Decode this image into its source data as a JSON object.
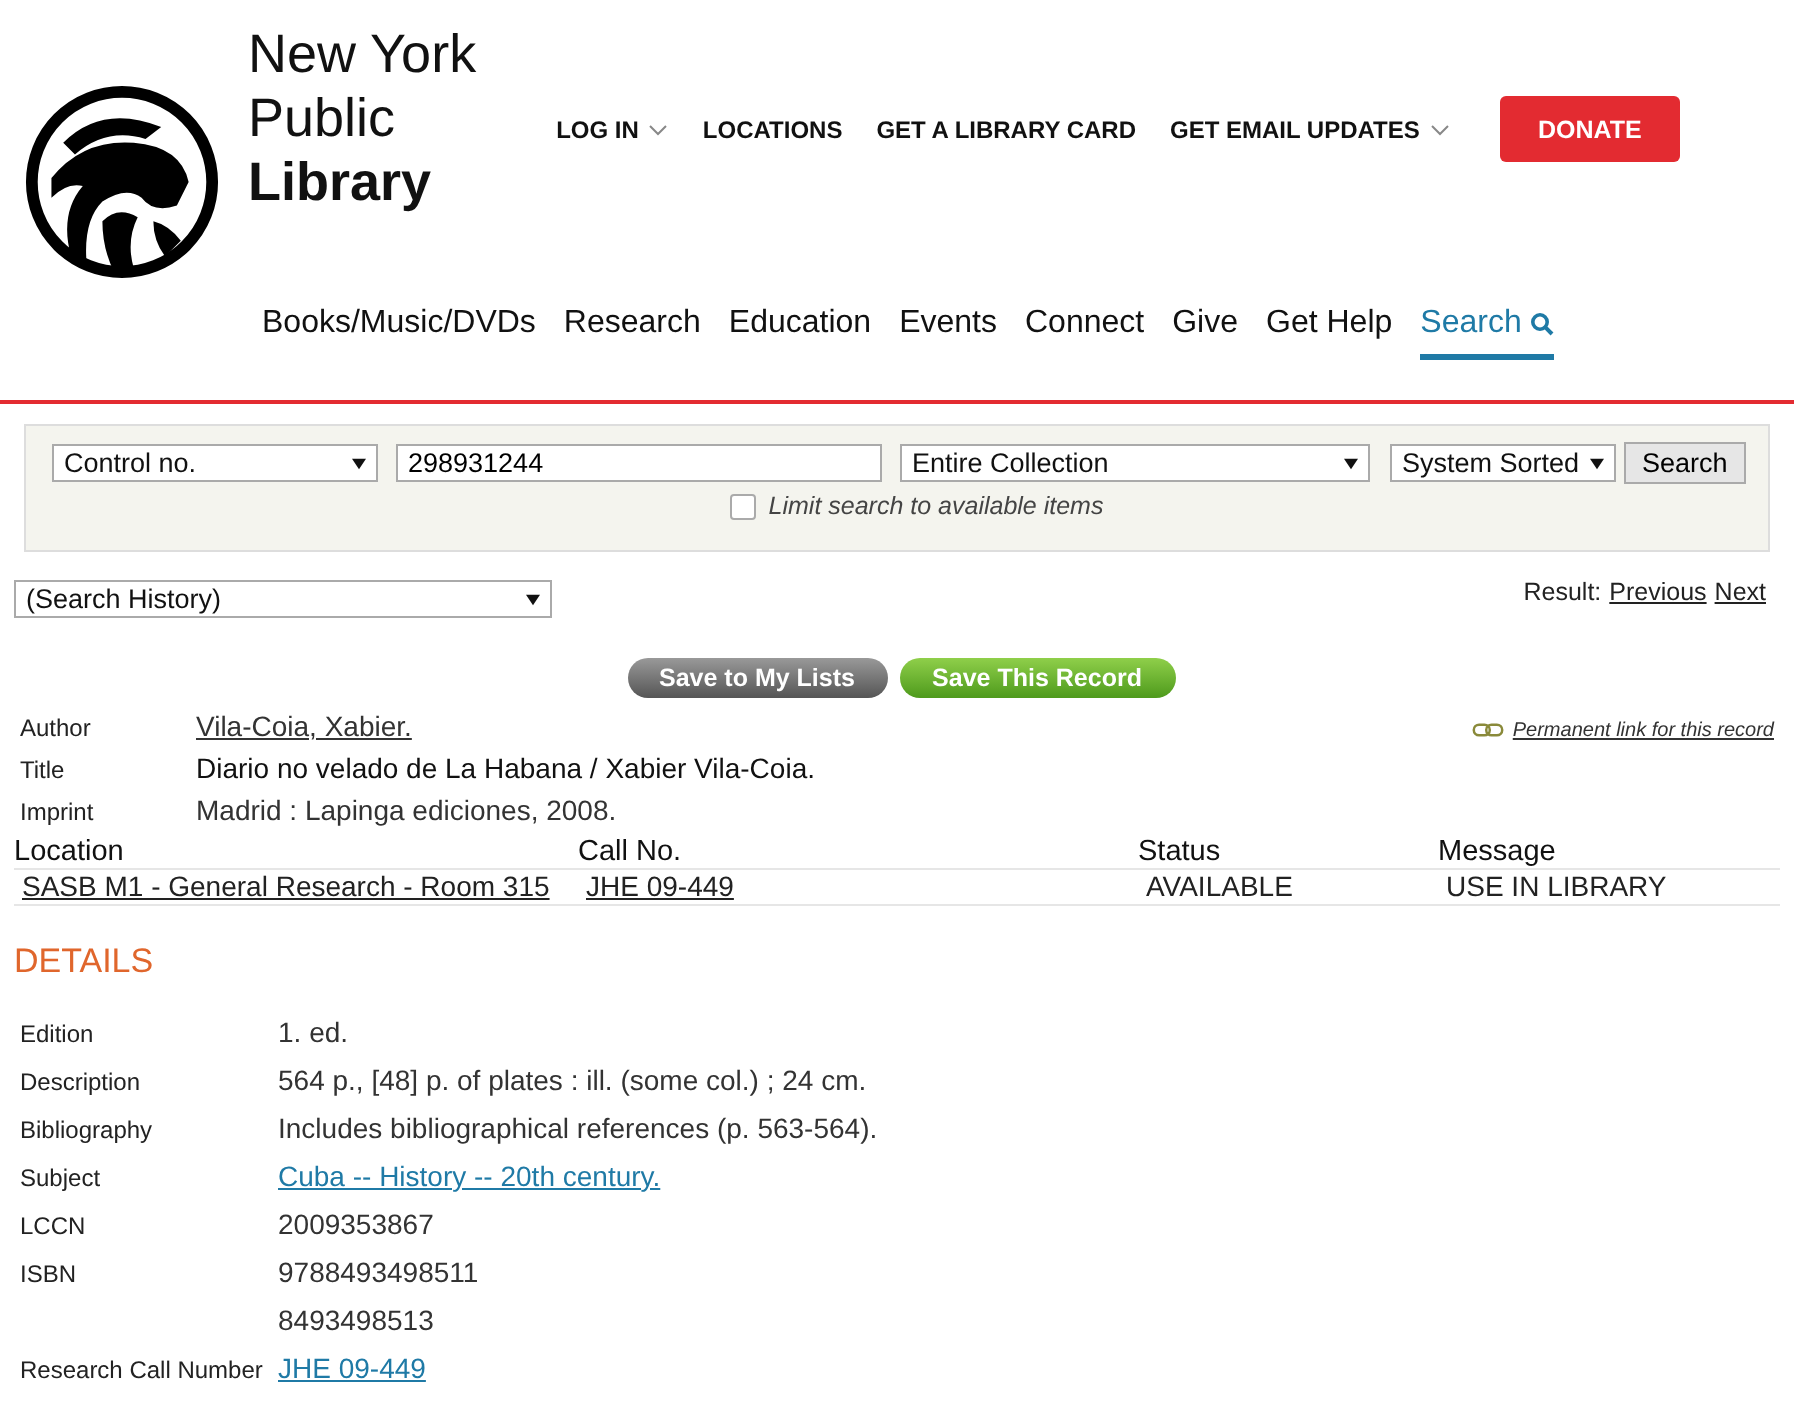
{
  "header": {
    "logo_lines": [
      "New York",
      "Public",
      "Library"
    ],
    "top_nav": [
      {
        "label": "LOG IN",
        "has_menu": true
      },
      {
        "label": "LOCATIONS",
        "has_menu": false
      },
      {
        "label": "GET A LIBRARY CARD",
        "has_menu": false
      },
      {
        "label": "GET EMAIL UPDATES",
        "has_menu": true
      }
    ],
    "donate": "DONATE",
    "main_nav": [
      {
        "label": "Books/Music/DVDs",
        "selected": false
      },
      {
        "label": "Research",
        "selected": false
      },
      {
        "label": "Education",
        "selected": false
      },
      {
        "label": "Events",
        "selected": false
      },
      {
        "label": "Connect",
        "selected": false
      },
      {
        "label": "Give",
        "selected": false
      },
      {
        "label": "Get Help",
        "selected": false
      },
      {
        "label": "Search",
        "selected": true
      }
    ]
  },
  "search_form": {
    "field_select": "Control no.",
    "query": "298931244",
    "scope_select": "Entire Collection",
    "sort_select": "System Sorted",
    "button": "Search",
    "limit": {
      "label": "Limit search to available items",
      "checked": false
    }
  },
  "search_history": "(Search History)",
  "result_nav": {
    "label": "Result:",
    "links": [
      "Previous",
      "Next"
    ]
  },
  "actions": [
    {
      "label": "Save to My Lists",
      "kind": "grey"
    },
    {
      "label": "Save This Record",
      "kind": "green"
    }
  ],
  "permanent_link": "Permanent link for this record",
  "record": [
    {
      "label": "Author",
      "value": "Vila-Coia, Xabier.",
      "link": true
    },
    {
      "label": "Title",
      "value": "Diario no velado de La Habana / Xabier Vila-Coia.",
      "link": false
    },
    {
      "label": "Imprint",
      "value": "Madrid : Lapinga ediciones, 2008.",
      "link": false
    }
  ],
  "holdings": {
    "columns": [
      "Location",
      "Call No.",
      "Status",
      "Message"
    ],
    "rows": [
      [
        {
          "text": "SASB M1 - General Research - Room 315",
          "link": true
        },
        {
          "text": "JHE 09-449",
          "link": true
        },
        {
          "text": "AVAILABLE",
          "link": false
        },
        {
          "text": "USE IN LIBRARY",
          "link": false
        }
      ]
    ]
  },
  "details": {
    "heading": "DETAILS",
    "fields": [
      {
        "label": "Edition",
        "values": [
          {
            "text": "1. ed.",
            "link": false
          }
        ]
      },
      {
        "label": "Description",
        "values": [
          {
            "text": "564 p., [48] p. of plates : ill. (some col.) ; 24 cm.",
            "link": false
          }
        ]
      },
      {
        "label": "Bibliography",
        "values": [
          {
            "text": "Includes bibliographical references (p. 563-564).",
            "link": false
          }
        ]
      },
      {
        "label": "Subject",
        "values": [
          {
            "text": "Cuba -- History -- 20th century.",
            "link": true
          }
        ]
      },
      {
        "label": "LCCN",
        "values": [
          {
            "text": "2009353867",
            "link": false
          }
        ]
      },
      {
        "label": "ISBN",
        "values": [
          {
            "text": "9788493498511",
            "link": false
          },
          {
            "text": "8493498513",
            "link": false
          }
        ]
      },
      {
        "label": "Research Call Number",
        "values": [
          {
            "text": "JHE 09-449",
            "link": true
          }
        ]
      }
    ]
  }
}
